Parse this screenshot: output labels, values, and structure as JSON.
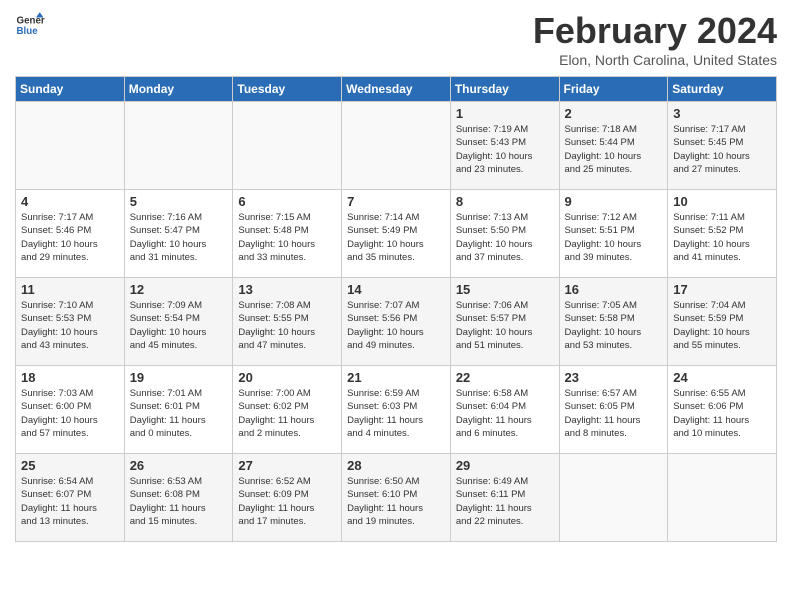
{
  "header": {
    "logo_line1": "General",
    "logo_line2": "Blue",
    "title": "February 2024",
    "subtitle": "Elon, North Carolina, United States"
  },
  "days_of_week": [
    "Sunday",
    "Monday",
    "Tuesday",
    "Wednesday",
    "Thursday",
    "Friday",
    "Saturday"
  ],
  "weeks": [
    [
      {
        "num": "",
        "info": ""
      },
      {
        "num": "",
        "info": ""
      },
      {
        "num": "",
        "info": ""
      },
      {
        "num": "",
        "info": ""
      },
      {
        "num": "1",
        "info": "Sunrise: 7:19 AM\nSunset: 5:43 PM\nDaylight: 10 hours\nand 23 minutes."
      },
      {
        "num": "2",
        "info": "Sunrise: 7:18 AM\nSunset: 5:44 PM\nDaylight: 10 hours\nand 25 minutes."
      },
      {
        "num": "3",
        "info": "Sunrise: 7:17 AM\nSunset: 5:45 PM\nDaylight: 10 hours\nand 27 minutes."
      }
    ],
    [
      {
        "num": "4",
        "info": "Sunrise: 7:17 AM\nSunset: 5:46 PM\nDaylight: 10 hours\nand 29 minutes."
      },
      {
        "num": "5",
        "info": "Sunrise: 7:16 AM\nSunset: 5:47 PM\nDaylight: 10 hours\nand 31 minutes."
      },
      {
        "num": "6",
        "info": "Sunrise: 7:15 AM\nSunset: 5:48 PM\nDaylight: 10 hours\nand 33 minutes."
      },
      {
        "num": "7",
        "info": "Sunrise: 7:14 AM\nSunset: 5:49 PM\nDaylight: 10 hours\nand 35 minutes."
      },
      {
        "num": "8",
        "info": "Sunrise: 7:13 AM\nSunset: 5:50 PM\nDaylight: 10 hours\nand 37 minutes."
      },
      {
        "num": "9",
        "info": "Sunrise: 7:12 AM\nSunset: 5:51 PM\nDaylight: 10 hours\nand 39 minutes."
      },
      {
        "num": "10",
        "info": "Sunrise: 7:11 AM\nSunset: 5:52 PM\nDaylight: 10 hours\nand 41 minutes."
      }
    ],
    [
      {
        "num": "11",
        "info": "Sunrise: 7:10 AM\nSunset: 5:53 PM\nDaylight: 10 hours\nand 43 minutes."
      },
      {
        "num": "12",
        "info": "Sunrise: 7:09 AM\nSunset: 5:54 PM\nDaylight: 10 hours\nand 45 minutes."
      },
      {
        "num": "13",
        "info": "Sunrise: 7:08 AM\nSunset: 5:55 PM\nDaylight: 10 hours\nand 47 minutes."
      },
      {
        "num": "14",
        "info": "Sunrise: 7:07 AM\nSunset: 5:56 PM\nDaylight: 10 hours\nand 49 minutes."
      },
      {
        "num": "15",
        "info": "Sunrise: 7:06 AM\nSunset: 5:57 PM\nDaylight: 10 hours\nand 51 minutes."
      },
      {
        "num": "16",
        "info": "Sunrise: 7:05 AM\nSunset: 5:58 PM\nDaylight: 10 hours\nand 53 minutes."
      },
      {
        "num": "17",
        "info": "Sunrise: 7:04 AM\nSunset: 5:59 PM\nDaylight: 10 hours\nand 55 minutes."
      }
    ],
    [
      {
        "num": "18",
        "info": "Sunrise: 7:03 AM\nSunset: 6:00 PM\nDaylight: 10 hours\nand 57 minutes."
      },
      {
        "num": "19",
        "info": "Sunrise: 7:01 AM\nSunset: 6:01 PM\nDaylight: 11 hours\nand 0 minutes."
      },
      {
        "num": "20",
        "info": "Sunrise: 7:00 AM\nSunset: 6:02 PM\nDaylight: 11 hours\nand 2 minutes."
      },
      {
        "num": "21",
        "info": "Sunrise: 6:59 AM\nSunset: 6:03 PM\nDaylight: 11 hours\nand 4 minutes."
      },
      {
        "num": "22",
        "info": "Sunrise: 6:58 AM\nSunset: 6:04 PM\nDaylight: 11 hours\nand 6 minutes."
      },
      {
        "num": "23",
        "info": "Sunrise: 6:57 AM\nSunset: 6:05 PM\nDaylight: 11 hours\nand 8 minutes."
      },
      {
        "num": "24",
        "info": "Sunrise: 6:55 AM\nSunset: 6:06 PM\nDaylight: 11 hours\nand 10 minutes."
      }
    ],
    [
      {
        "num": "25",
        "info": "Sunrise: 6:54 AM\nSunset: 6:07 PM\nDaylight: 11 hours\nand 13 minutes."
      },
      {
        "num": "26",
        "info": "Sunrise: 6:53 AM\nSunset: 6:08 PM\nDaylight: 11 hours\nand 15 minutes."
      },
      {
        "num": "27",
        "info": "Sunrise: 6:52 AM\nSunset: 6:09 PM\nDaylight: 11 hours\nand 17 minutes."
      },
      {
        "num": "28",
        "info": "Sunrise: 6:50 AM\nSunset: 6:10 PM\nDaylight: 11 hours\nand 19 minutes."
      },
      {
        "num": "29",
        "info": "Sunrise: 6:49 AM\nSunset: 6:11 PM\nDaylight: 11 hours\nand 22 minutes."
      },
      {
        "num": "",
        "info": ""
      },
      {
        "num": "",
        "info": ""
      }
    ]
  ]
}
